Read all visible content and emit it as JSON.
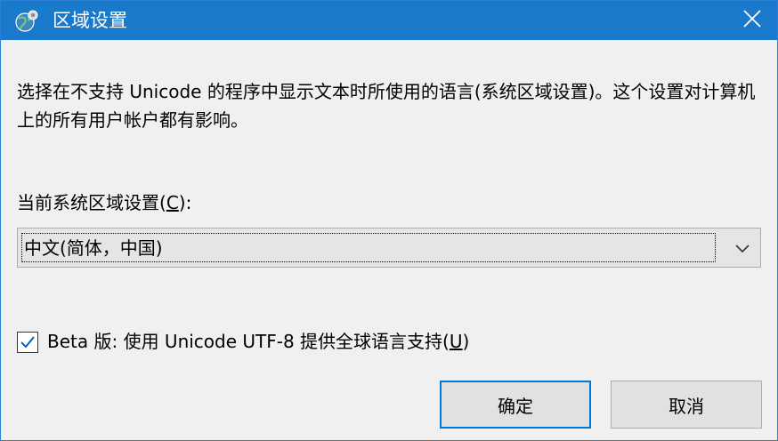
{
  "window": {
    "title": "区域设置",
    "accent_color": "#1979ca",
    "icons": {
      "app": "globe-settings-icon",
      "close": "close-icon"
    }
  },
  "description": "选择在不支持 Unicode 的程序中显示文本时所使用的语言(系统区域设置)。这个设置对计算机上的所有用户帐户都有影响。",
  "current_locale": {
    "label_prefix": "当前系统区域设置(",
    "label_access_key": "C",
    "label_suffix": "):",
    "selected_value": "中文(简体，中国)",
    "dropdown_icon": "chevron-down-icon"
  },
  "beta_option": {
    "checked": true,
    "label_prefix": "Beta 版: 使用 Unicode UTF-8 提供全球语言支持(",
    "label_access_key": "U",
    "label_suffix": ")",
    "icon": "checkmark-icon"
  },
  "buttons": {
    "ok_label": "确定",
    "cancel_label": "取消"
  }
}
